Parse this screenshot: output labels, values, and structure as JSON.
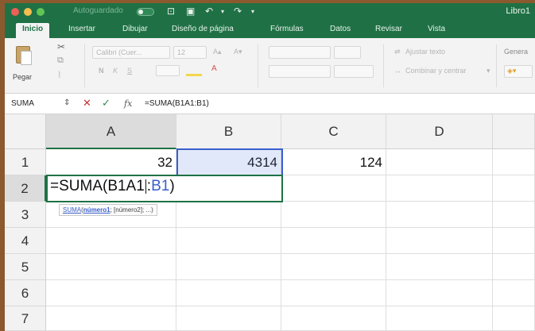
{
  "titlebar": {
    "autosave_label": "Autoguardado",
    "autosave_state": "OFF",
    "workbook_title": "Libro1",
    "traffic_light_colors": [
      "#ee5f57",
      "#f5bd4f",
      "#61c554"
    ]
  },
  "ribbon_tabs": [
    "Inicio",
    "Insertar",
    "Dibujar",
    "Diseño de página",
    "Fórmulas",
    "Datos",
    "Revisar",
    "Vista"
  ],
  "active_tab": "Inicio",
  "ribbon": {
    "paste_label": "Pegar",
    "font_name": "Calibri (Cuer...",
    "font_size": "12",
    "bold_label": "N",
    "italic_label": "K",
    "underline_label": "S",
    "wrap_text_label": "Ajustar texto",
    "merge_label": "Combinar y centrar",
    "number_format": "Genera"
  },
  "formula_bar": {
    "name_box": "SUMA",
    "cancel_icon": "✕",
    "enter_icon": "✓",
    "fx_label": "fx",
    "formula": "=SUMA(B1A1:B1)"
  },
  "grid": {
    "columns": [
      "A",
      "B",
      "C",
      "D"
    ],
    "rows": [
      "1",
      "2",
      "3",
      "4",
      "5",
      "6",
      "7"
    ],
    "cells": {
      "A1": "32",
      "B1": "4314",
      "C1": "124"
    },
    "editing_cell": "A2",
    "edit_text_prefix": "=SUMA(B1A1",
    "edit_text_colon": ":",
    "edit_text_ref": "B1",
    "edit_text_suffix": ")",
    "tooltip": {
      "function": "SUMA",
      "arg1": "número1",
      "rest": "; [número2]; ...)"
    }
  },
  "colors": {
    "excel_green": "#1f7145",
    "reference_blue": "#3a5fcd"
  }
}
